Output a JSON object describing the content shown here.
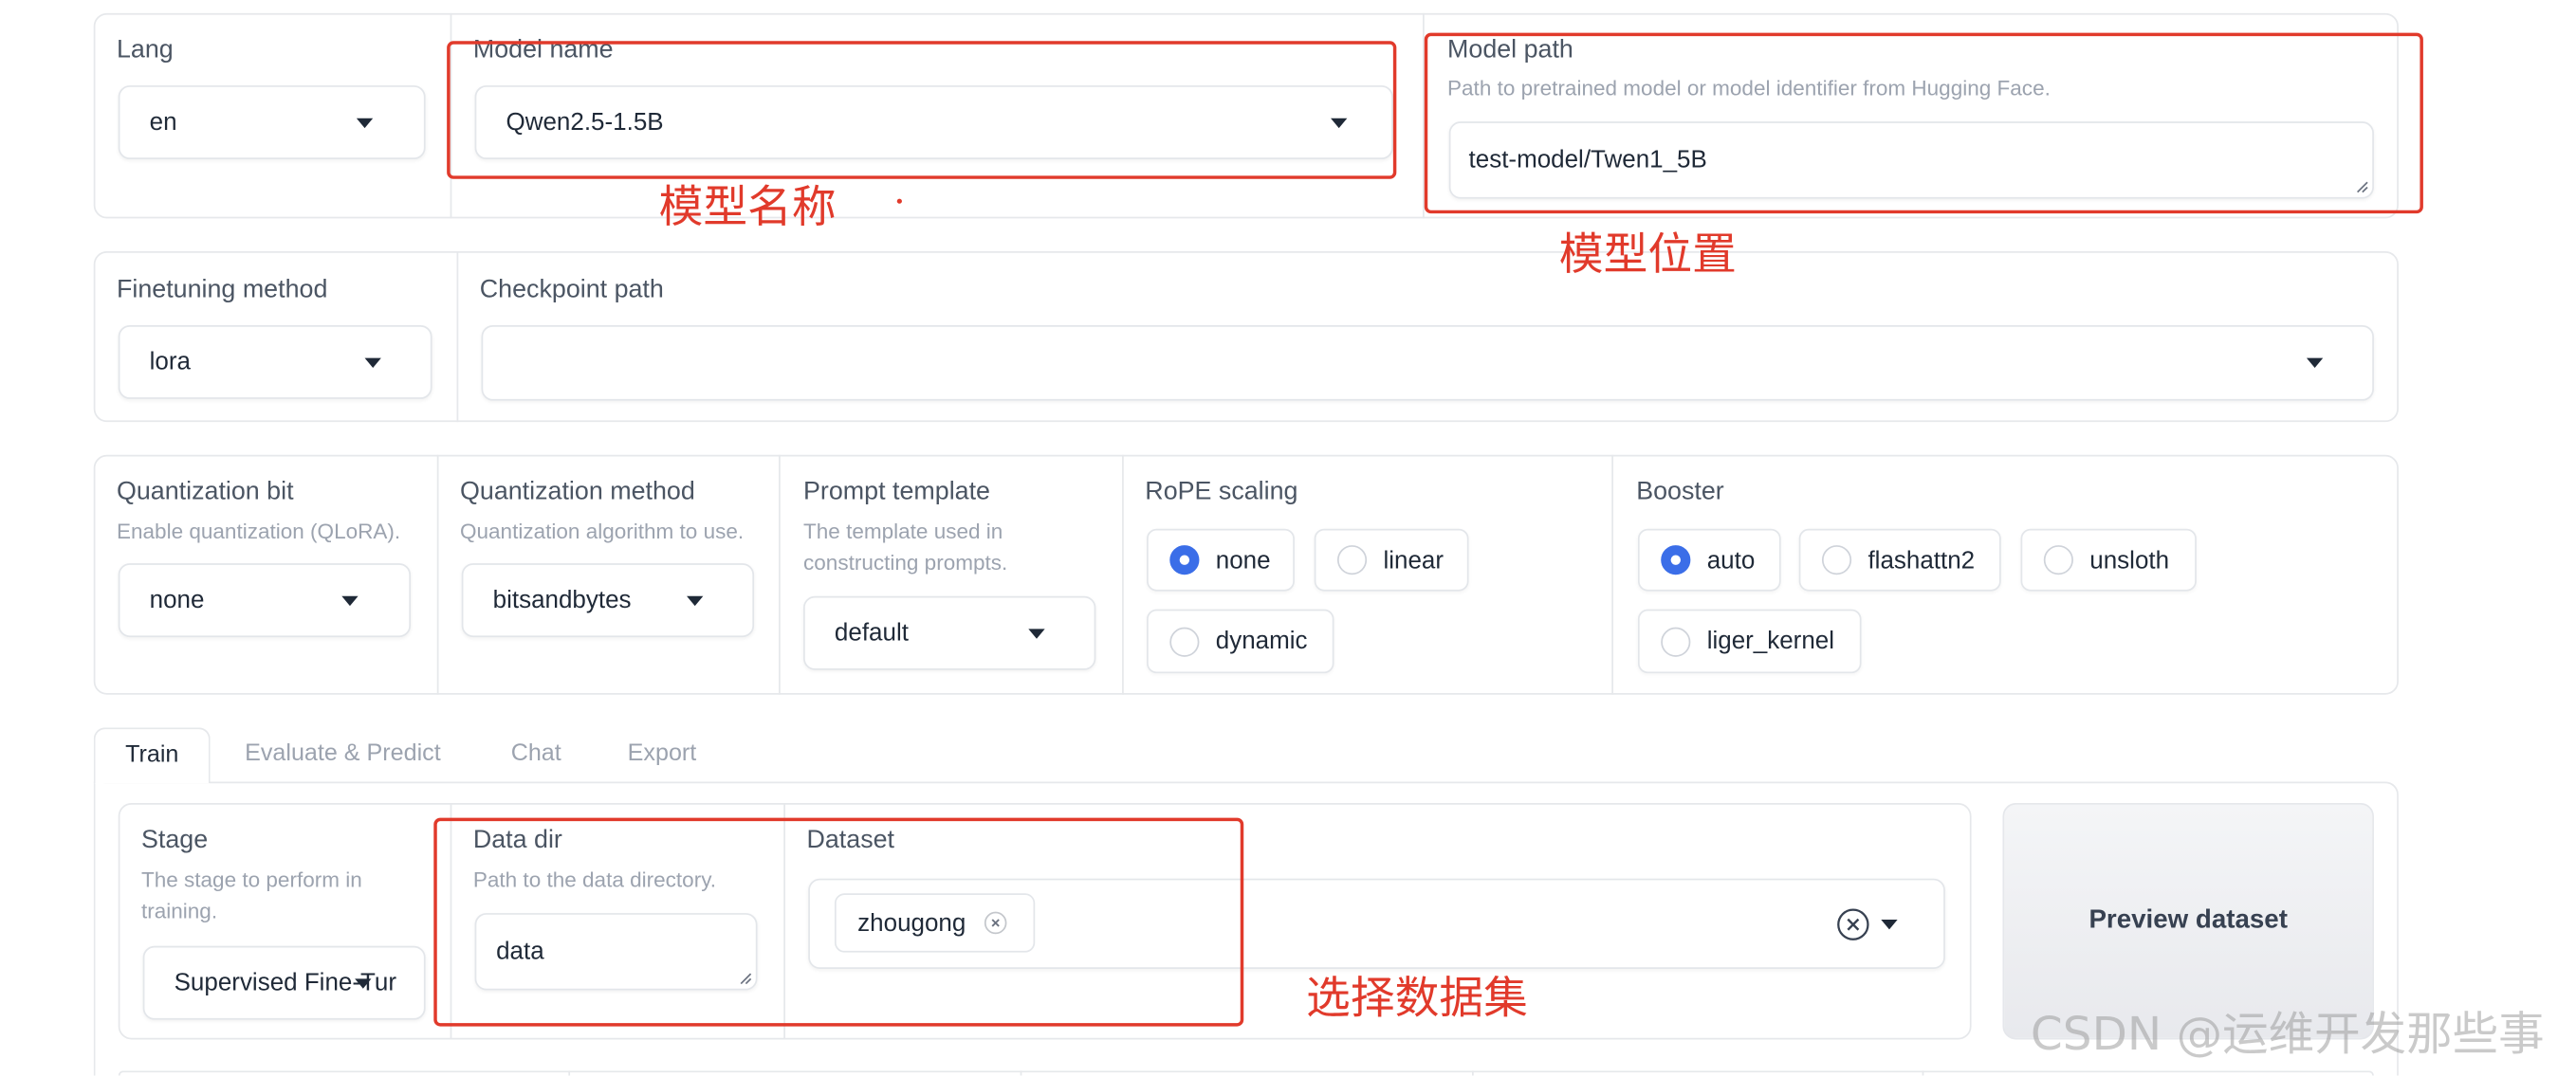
{
  "model_row": {
    "lang": {
      "label": "Lang",
      "value": "en"
    },
    "model_name": {
      "label": "Model name",
      "value": "Qwen2.5-1.5B"
    },
    "model_path": {
      "label": "Model path",
      "info": "Path to pretrained model or model identifier from Hugging Face.",
      "value": "test-model/Twen1_5B"
    }
  },
  "finetune_row": {
    "finetuning_method": {
      "label": "Finetuning method",
      "value": "lora"
    },
    "checkpoint_path": {
      "label": "Checkpoint path",
      "value": ""
    }
  },
  "advanced_row": {
    "quantization_bit": {
      "label": "Quantization bit",
      "info": "Enable quantization (QLoRA).",
      "value": "none"
    },
    "quantization_method": {
      "label": "Quantization method",
      "info": "Quantization algorithm to use.",
      "value": "bitsandbytes"
    },
    "prompt_template": {
      "label": "Prompt template",
      "info_lines": [
        "The template used in",
        "constructing prompts."
      ],
      "value": "default"
    },
    "rope_scaling": {
      "label": "RoPE scaling",
      "options": [
        {
          "label": "none",
          "checked": true
        },
        {
          "label": "linear",
          "checked": false
        },
        {
          "label": "dynamic",
          "checked": false
        }
      ]
    },
    "booster": {
      "label": "Booster",
      "options": [
        {
          "label": "auto",
          "checked": true
        },
        {
          "label": "flashattn2",
          "checked": false
        },
        {
          "label": "unsloth",
          "checked": false
        },
        {
          "label": "liger_kernel",
          "checked": false
        }
      ]
    }
  },
  "tabs": [
    {
      "label": "Train",
      "active": true
    },
    {
      "label": "Evaluate & Predict",
      "active": false
    },
    {
      "label": "Chat",
      "active": false
    },
    {
      "label": "Export",
      "active": false
    }
  ],
  "train": {
    "stage": {
      "label": "Stage",
      "info_lines": [
        "The stage to perform in",
        "training."
      ],
      "value": "Supervised Fine-Tur"
    },
    "data_dir": {
      "label": "Data dir",
      "info": "Path to the data directory.",
      "value": "data"
    },
    "dataset": {
      "label": "Dataset",
      "chips": [
        "zhougong"
      ]
    },
    "preview_button": {
      "label": "Preview dataset"
    }
  },
  "annotations": {
    "model_name_note": "模型名称",
    "model_path_note": "模型位置",
    "dataset_note": "选择数据集"
  },
  "watermark": "CSDN @运维开发那些事",
  "icons": {
    "dropdown_arrow": "caret-down-icon",
    "textarea_resize": "resize-handle-icon",
    "chip_remove": "chip-remove-icon",
    "clear_selection": "clear-selection-icon",
    "radio": "radio-button-icon"
  },
  "colors": {
    "accent": "#3b6ee8",
    "annotation_red": "#e13a2b",
    "border": "#e6e8eb",
    "label_text": "#4b5563",
    "muted_text": "#9ca3af"
  }
}
